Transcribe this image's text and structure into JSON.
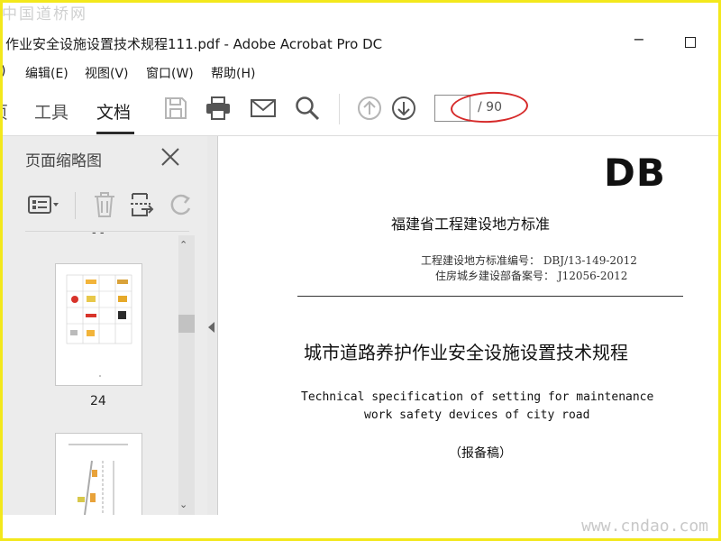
{
  "watermark": {
    "top": "中国道桥网",
    "bottom": "www.cndao.com"
  },
  "window": {
    "title": "作业安全设施设置技术规程111.pdf - Adobe Acrobat Pro DC",
    "minimize": "−"
  },
  "menu": [
    "编辑(E)",
    "视图(V)",
    "窗口(W)",
    "帮助(H)"
  ],
  "menu_cut": ")",
  "toolbar": {
    "cut_tab": "页",
    "tabs": [
      "工具",
      "文档"
    ],
    "active_tab": "文档",
    "page_number": "",
    "page_total": "/ 90",
    "icons": [
      "save-icon",
      "print-icon",
      "email-icon",
      "search-icon",
      "page-up-icon",
      "page-down-icon"
    ],
    "highlight_color": "#d62a2a"
  },
  "sidepanel": {
    "title": "页面缩略图",
    "dash": "- -",
    "thumb_label": "24",
    "tool_icons": [
      "thumbnail-options-icon",
      "delete-page-icon",
      "extract-page-icon",
      "rotate-page-icon"
    ]
  },
  "document": {
    "code": "DB",
    "standard": "福建省工程建设地方标准",
    "meta_line1": "工程建设地方标准编号： DBJ/13-149-2012",
    "meta_line2": "住房城乡建设部备案号： J12056-2012",
    "title_cn": "城市道路养护作业安全设施设置技术规程",
    "title_en_line1": "Technical specification of setting for maintenance",
    "title_en_line2": "work safety devices of city road",
    "draft": "（报备稿）"
  }
}
